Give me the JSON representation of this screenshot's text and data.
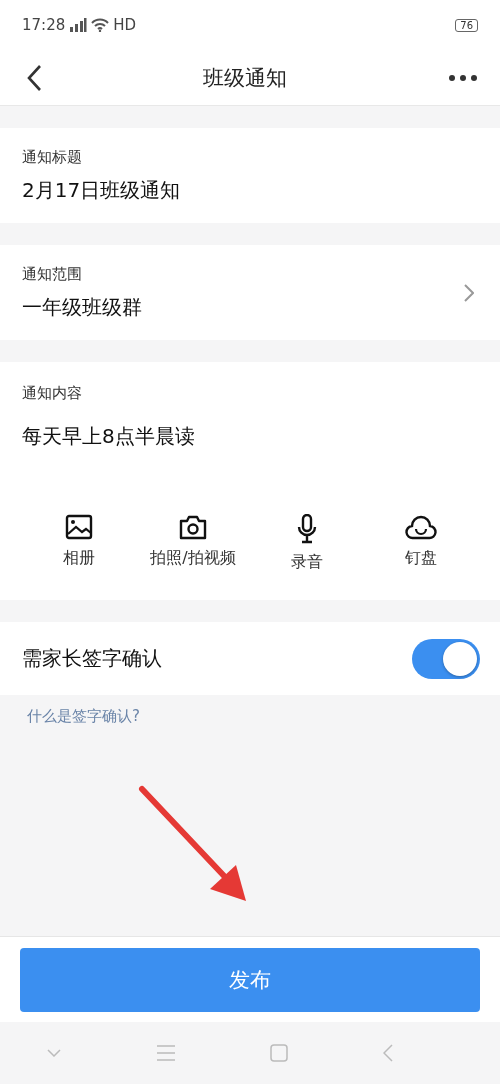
{
  "status_bar": {
    "time": "17:28",
    "network": "HD",
    "battery": "76"
  },
  "nav": {
    "title": "班级通知"
  },
  "fields": [
    {
      "label": "通知标题",
      "value": "2月17日班级通知",
      "kind": "text"
    },
    {
      "label": "通知范围",
      "value": "一年级班级群",
      "kind": "select"
    }
  ],
  "content": {
    "label": "通知内容",
    "value": "每天早上8点半晨读",
    "attachments": [
      {
        "label": "相册",
        "kind": "album"
      },
      {
        "label": "拍照/拍视频",
        "kind": "camera"
      },
      {
        "label": "录音",
        "kind": "mic"
      },
      {
        "label": "钉盘",
        "kind": "cloud"
      }
    ]
  },
  "signature": {
    "label": "需家长签字确认",
    "on": true,
    "help_link": "什么是签字确认?"
  },
  "publish_button": "发布"
}
